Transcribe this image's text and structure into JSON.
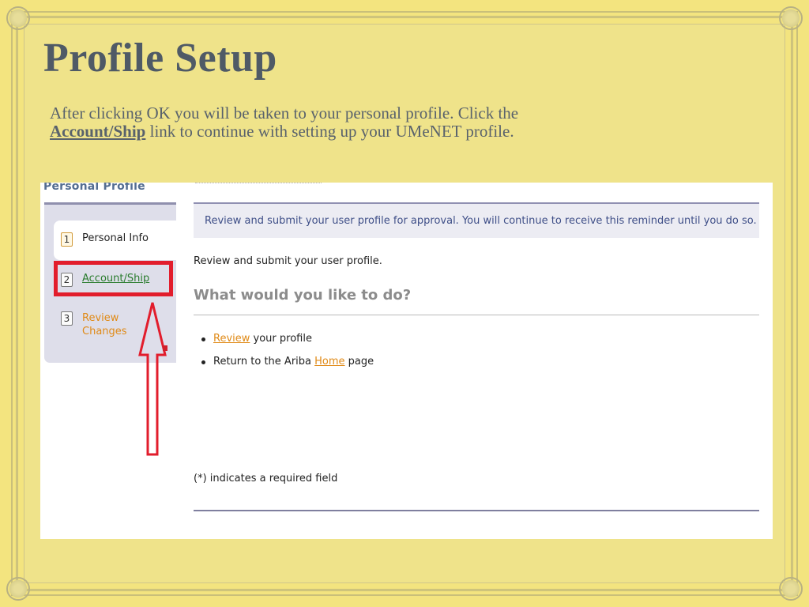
{
  "slide": {
    "title": "Profile Setup",
    "body_before": "After clicking OK you will be taken to your personal profile. Click the",
    "body_link": "Account/Ship",
    "body_after": " link to continue with setting up your UMeNET profile."
  },
  "screenshot": {
    "panel_title": "Personal Profile",
    "steps": [
      {
        "number": "1",
        "label": "Personal Info"
      },
      {
        "number": "2",
        "label": "Account/Ship"
      },
      {
        "number": "3",
        "label": "Review Changes"
      }
    ],
    "notice": "Review and submit your user profile for approval. You will continue to receive this reminder until you do so.",
    "intro": "Review and submit your user profile.",
    "question": "What would you like to do?",
    "options": {
      "review_link": "Review",
      "review_suffix": " your profile",
      "home_prefix": "Return to the Ariba ",
      "home_link": "Home",
      "home_suffix": " page"
    },
    "required_note": "(*) indicates a required field"
  },
  "colors": {
    "slide_background": "#f3e47f",
    "title_color": "#4f5a66",
    "highlight_red": "#e21d2c",
    "link_green": "#2a7c2e",
    "link_orange": "#e08a17"
  }
}
